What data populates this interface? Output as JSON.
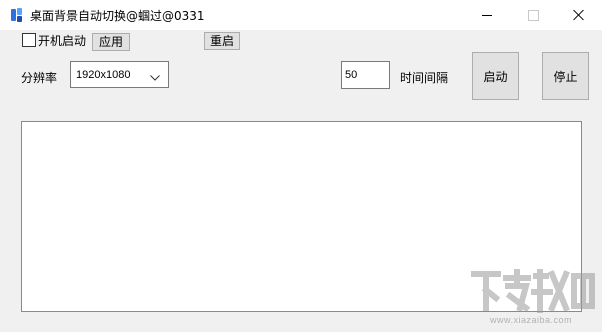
{
  "window": {
    "title": "桌面背景自动切换@蝈过@0331",
    "icon": "app-icon",
    "controls": {
      "minimize": "minimize-icon",
      "maximize": "maximize-icon",
      "close": "close-icon"
    }
  },
  "settings": {
    "autostart_checked": false,
    "autostart_label": "开机启动",
    "apply_label": "应用",
    "restart_label": "重启"
  },
  "resolution": {
    "label": "分辨率",
    "selected": "1920x1080"
  },
  "interval": {
    "value": "50",
    "label": "时间间隔"
  },
  "actions": {
    "start_label": "启动",
    "stop_label": "停止"
  },
  "log": {
    "content": ""
  },
  "watermark": {
    "url": "www.xiazaiba.com"
  },
  "colors": {
    "window_bg": "#f0f0f0",
    "titlebar_bg": "#ffffff",
    "button_bg": "#e1e1e1",
    "button_border": "#adadad",
    "app_icon_accent": "#2f6fe0"
  }
}
